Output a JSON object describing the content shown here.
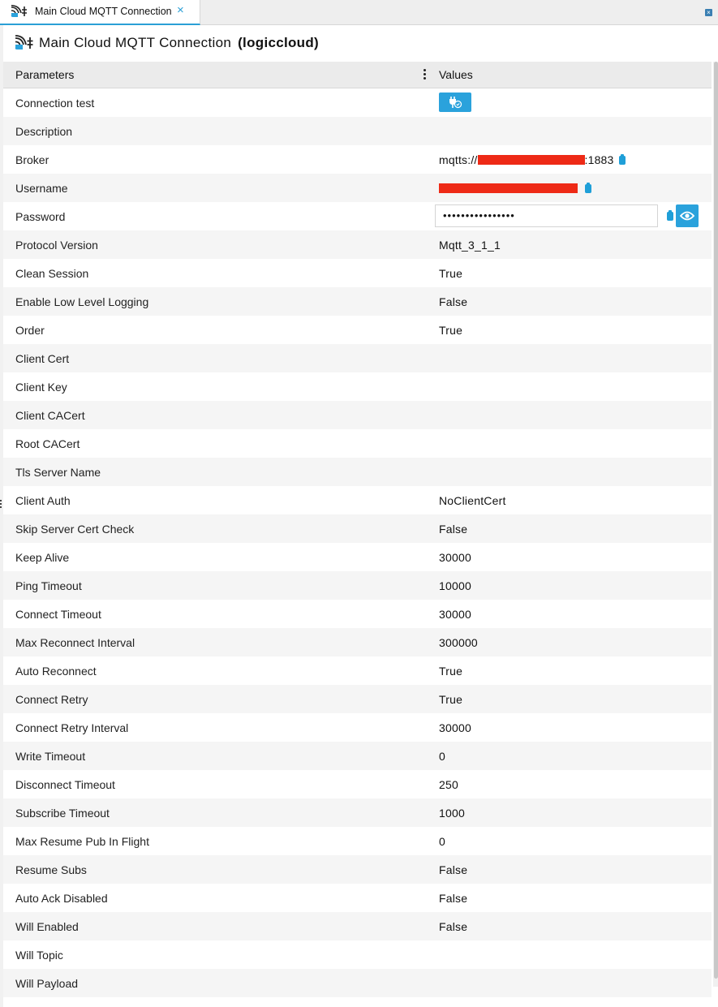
{
  "tab": {
    "label": "Main Cloud MQTT Connection",
    "close": "×"
  },
  "header": {
    "title": "Main Cloud MQTT Connection",
    "subtitle": "(logiccloud)"
  },
  "table": {
    "col_params": "Parameters",
    "col_values": "Values",
    "broker_prefix": "mqtts://",
    "broker_suffix": ":1883",
    "password_mask": "••••••••••••••••",
    "rows": [
      {
        "param": "Connection test",
        "value": ""
      },
      {
        "param": "Description",
        "value": ""
      },
      {
        "param": "Broker",
        "value": ""
      },
      {
        "param": "Username",
        "value": ""
      },
      {
        "param": "Password",
        "value": ""
      },
      {
        "param": "Protocol Version",
        "value": "Mqtt_3_1_1"
      },
      {
        "param": "Clean Session",
        "value": "True"
      },
      {
        "param": "Enable Low Level Logging",
        "value": "False"
      },
      {
        "param": "Order",
        "value": "True"
      },
      {
        "param": "Client Cert",
        "value": ""
      },
      {
        "param": "Client Key",
        "value": ""
      },
      {
        "param": "Client CACert",
        "value": ""
      },
      {
        "param": "Root CACert",
        "value": ""
      },
      {
        "param": "Tls Server Name",
        "value": ""
      },
      {
        "param": "Client Auth",
        "value": "NoClientCert"
      },
      {
        "param": "Skip Server Cert Check",
        "value": "False"
      },
      {
        "param": "Keep Alive",
        "value": "30000"
      },
      {
        "param": "Ping Timeout",
        "value": "10000"
      },
      {
        "param": "Connect Timeout",
        "value": "30000"
      },
      {
        "param": "Max Reconnect Interval",
        "value": "300000"
      },
      {
        "param": "Auto Reconnect",
        "value": "True"
      },
      {
        "param": "Connect Retry",
        "value": "True"
      },
      {
        "param": "Connect Retry Interval",
        "value": "30000"
      },
      {
        "param": "Write Timeout",
        "value": "0"
      },
      {
        "param": "Disconnect Timeout",
        "value": "250"
      },
      {
        "param": "Subscribe Timeout",
        "value": "1000"
      },
      {
        "param": "Max Resume Pub In Flight",
        "value": "0"
      },
      {
        "param": "Resume Subs",
        "value": "False"
      },
      {
        "param": "Auto Ack Disabled",
        "value": "False"
      },
      {
        "param": "Will Enabled",
        "value": "False"
      },
      {
        "param": "Will Topic",
        "value": ""
      },
      {
        "param": "Will Payload",
        "value": ""
      }
    ]
  },
  "icons": {
    "app": "mqtt-connection-icon",
    "connection_test": "plug-check-icon",
    "copy": "clipboard-icon",
    "reveal": "eye-icon",
    "close": "close-icon",
    "column_menu": "kebab-menu-icon"
  },
  "colors": {
    "accent": "#2aa2dc",
    "redaction": "#ee2a16"
  }
}
